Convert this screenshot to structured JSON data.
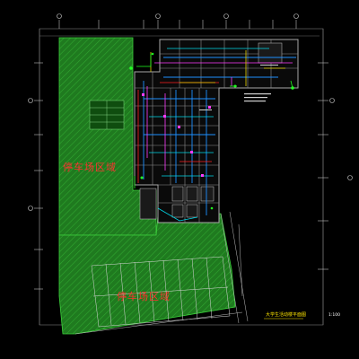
{
  "drawing": {
    "title": "大学生活动楼平面图",
    "scale_label": "1:100",
    "zone_labels": [
      {
        "id": "zone-upper",
        "text": "停车场区域"
      },
      {
        "id": "zone-lower",
        "text": "停车场区域"
      }
    ],
    "colors": {
      "background": "#000000",
      "hatch_green": "#1f7a1f",
      "hatch_line": "#2fa52f",
      "wall_grey": "#9a9a9a",
      "pipe_blue": "#1e90ff",
      "pipe_cyan": "#00d8e8",
      "pipe_magenta": "#ff3cff",
      "pipe_red": "#ff2020",
      "pipe_yellow": "#e6d200",
      "pipe_green": "#22ff22",
      "grid_white": "#d0d0d0",
      "label_red": "#ff3030",
      "title_yellow": "#ffe600"
    }
  }
}
